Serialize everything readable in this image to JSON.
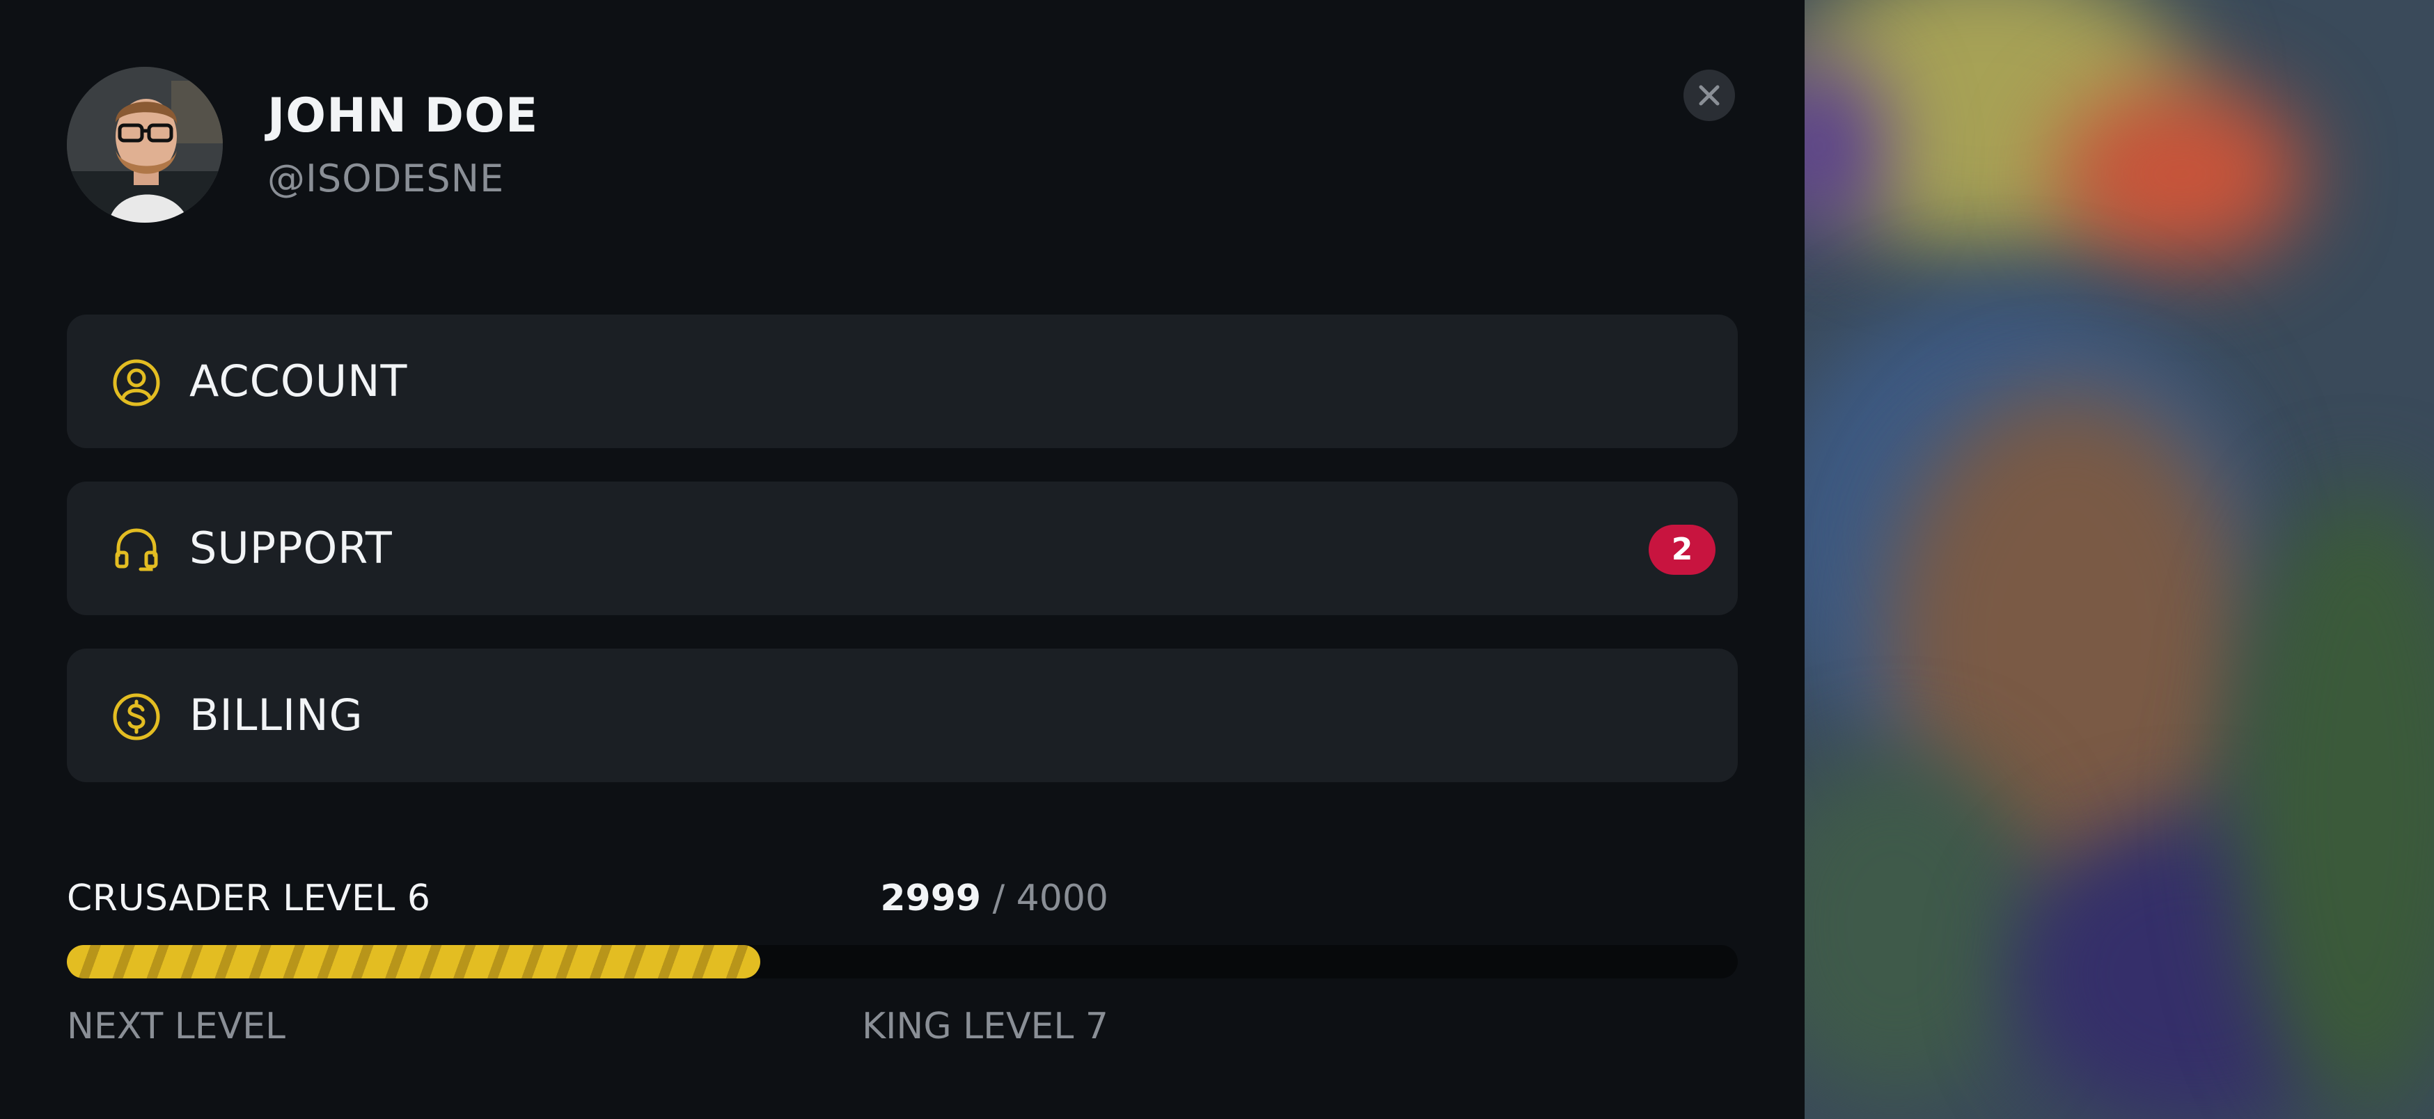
{
  "profile": {
    "name": "JOHN DOE",
    "handle": "@ISODESNE"
  },
  "menu": {
    "items": [
      {
        "label": "ACCOUNT",
        "icon": "user-circle-icon"
      },
      {
        "label": "SUPPORT",
        "icon": "headset-icon",
        "badge": "2"
      },
      {
        "label": "BILLING",
        "icon": "dollar-coin-icon"
      }
    ]
  },
  "level": {
    "title": "CRUSADER LEVEL 6",
    "current_points": "2999",
    "separator": "/",
    "max_points": "4000",
    "progress_fraction": 0.415,
    "next_label": "NEXT LEVEL",
    "next_level_name": "KING LEVEL 7"
  },
  "colors": {
    "accent": "#e3bd22",
    "badge": "#c8143f",
    "background": "#0d1014",
    "card": "#1b1f24"
  }
}
